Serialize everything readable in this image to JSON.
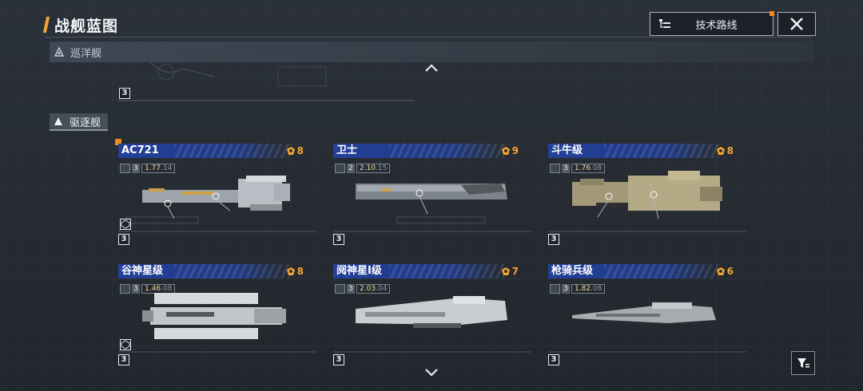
{
  "header": {
    "title": "战舰蓝图",
    "tech_route_label": "技术路线"
  },
  "sections": {
    "cruiser_label": "巡洋舰",
    "destroyer_label": "驱逐舰"
  },
  "ships": [
    {
      "name": "AC721",
      "tier": "8",
      "level": "3",
      "stat_main": "1.77",
      "stat_sub": ".14",
      "hull_number": "3"
    },
    {
      "name": "卫士",
      "tier": "9",
      "level": "2",
      "stat_main": "2.10",
      "stat_sub": ".15",
      "hull_number": "3"
    },
    {
      "name": "斗牛级",
      "tier": "8",
      "level": "3",
      "stat_main": "1.76",
      "stat_sub": ".08",
      "hull_number": "3"
    },
    {
      "name": "谷神星级",
      "tier": "8",
      "level": "3",
      "stat_main": "1.46",
      "stat_sub": ".08",
      "hull_number": "3"
    },
    {
      "name": "阋神星I级",
      "tier": "7",
      "level": "3",
      "stat_main": "2.03",
      "stat_sub": ".04",
      "hull_number": "3"
    },
    {
      "name": "枪骑兵级",
      "tier": "6",
      "level": "3",
      "stat_main": "1.82",
      "stat_sub": ".08",
      "hull_number": "3"
    }
  ],
  "cruiser_peek_hull_number": "3",
  "icons": {
    "tech_tree": "tech-tree-icon",
    "close": "close-icon",
    "filter": "filter-icon",
    "tier": "tier-emblem-icon",
    "scroll_up": "chevron-up-icon",
    "scroll_down": "chevron-down-icon"
  },
  "colors": {
    "accent": "#f28a1e",
    "tier_gold": "#f6a430",
    "name_strip_blue": "#23409a"
  }
}
